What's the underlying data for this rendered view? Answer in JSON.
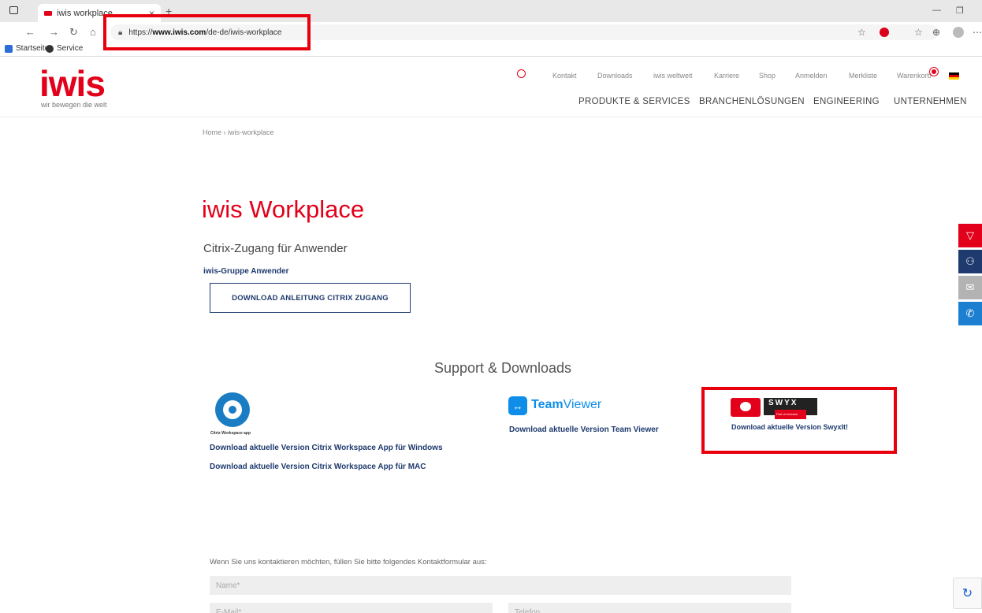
{
  "browser": {
    "tab_title": "iwis workplace",
    "tab_close": "×",
    "new_tab": "+",
    "url_prefix": "https://",
    "url_host": "www.iwis.com",
    "url_path": "/de-de/iwis-workplace",
    "bookmarks": [
      "Startseite",
      "Service"
    ]
  },
  "header": {
    "logo": "iwis",
    "tagline": "wir bewegen die welt",
    "top_links": [
      "Kontakt",
      "Downloads",
      "iwis weltweit",
      "Karriere",
      "Shop",
      "Anmelden",
      "Merkliste",
      "Warenkorb"
    ],
    "cart_count": "0",
    "main_nav": [
      "PRODUKTE & SERVICES",
      "BRANCHENLÖSUNGEN",
      "ENGINEERING",
      "UNTERNEHMEN"
    ]
  },
  "breadcrumb": "Home › iwis-workplace",
  "main": {
    "title": "iwis Workplace",
    "subtitle": "Citrix-Zugang für Anwender",
    "group_label": "iwis-Gruppe Anwender",
    "download_button": "DOWNLOAD ANLEITUNG CITRIX ZUGANG"
  },
  "support": {
    "heading": "Support & Downloads",
    "citrix_caption": "Citrix Workspace app",
    "citrix_win": "Download aktuelle Version Citrix Workspace App für Windows",
    "citrix_mac": "Download aktuelle Version Citrix Workspace App für MAC",
    "teamviewer_brand_a": "Team",
    "teamviewer_brand_b": "Viewer",
    "teamviewer_link": "Download aktuelle Version Team Viewer",
    "swyx_brand": "SWYX",
    "swyx_sub": "Part of enreach",
    "swyx_link": "Download aktuelle Version SwyxIt!"
  },
  "form": {
    "intro": "Wenn Sie uns kontaktieren möchten, füllen Sie bitte folgendes Kontaktformular aus:",
    "name_placeholder": "Name*",
    "email_placeholder": "E-Mail*",
    "phone_placeholder": "Telefon"
  },
  "colors": {
    "brand_red": "#e2001a",
    "navy": "#1e3a6e",
    "highlight_red": "#e8000d"
  }
}
